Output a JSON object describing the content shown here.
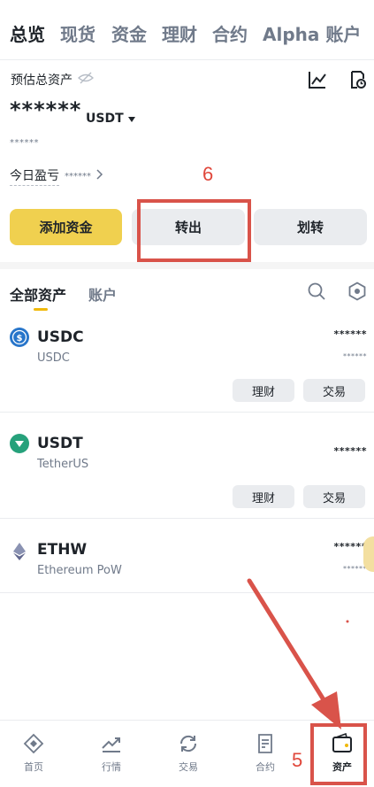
{
  "top_tabs": [
    "总览",
    "现货",
    "资金",
    "理财",
    "合约",
    "Alpha",
    "账户"
  ],
  "overview": {
    "estimated_label": "预估总资产",
    "balance_mask": "******",
    "unit": "USDT",
    "sub_mask": "******",
    "pnl_label": "今日盈亏",
    "pnl_mask": "******"
  },
  "actions": {
    "add_funds": "添加资金",
    "withdraw": "转出",
    "transfer": "划转"
  },
  "asset_tabs": {
    "all": "全部资产",
    "account": "账户"
  },
  "assets": [
    {
      "symbol": "USDC",
      "name": "USDC",
      "amount": "******",
      "sub_amount": "******",
      "chips": [
        "理财",
        "交易"
      ],
      "icon": "usdc-icon",
      "color": "#2775ca"
    },
    {
      "symbol": "USDT",
      "name": "TetherUS",
      "amount": "******",
      "chips": [
        "理财",
        "交易"
      ],
      "icon": "usdt-icon",
      "color": "#26a17b"
    },
    {
      "symbol": "ETHW",
      "name": "Ethereum PoW",
      "amount": "******",
      "sub_amount": "******",
      "icon": "ethw-icon",
      "color": "#8a92b2"
    }
  ],
  "bottom_nav": [
    "首页",
    "行情",
    "交易",
    "合约",
    "资产"
  ],
  "annotations": {
    "step5": "5",
    "step6": "6"
  },
  "colors": {
    "accent": "#f0d04f",
    "annotation": "#d9534a"
  }
}
